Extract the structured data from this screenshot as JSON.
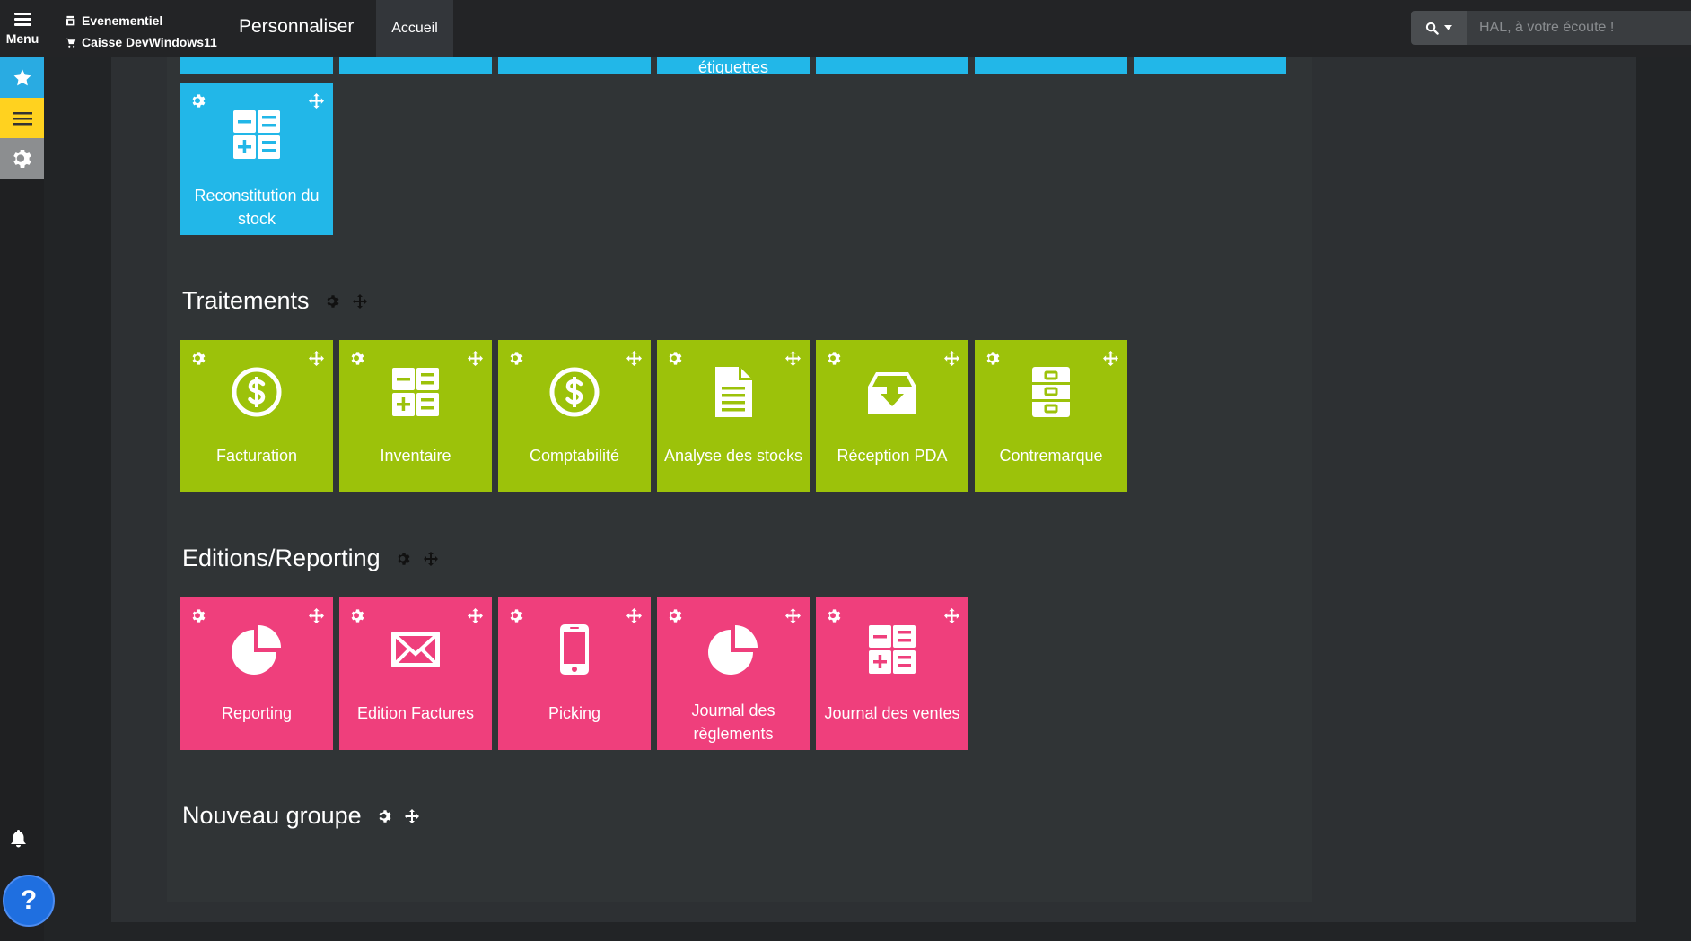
{
  "topbar": {
    "menu_label": "Menu",
    "site_line1": "Evenementiel",
    "site_line2": "Caisse DevWindows11",
    "title": "Personnaliser",
    "tab_home": "Accueil",
    "search_placeholder": "HAL, à votre écoute !"
  },
  "help_label": "?",
  "groups": {
    "top_partial": {
      "cut_label": "étiquettes"
    },
    "stock_tile": {
      "label": "Reconstitution du stock"
    },
    "traitements": {
      "title": "Traitements",
      "tiles": [
        {
          "label": "Facturation",
          "icon": "dollar-circle-icon"
        },
        {
          "label": "Inventaire",
          "icon": "calculator-icon"
        },
        {
          "label": "Comptabilité",
          "icon": "dollar-circle-icon"
        },
        {
          "label": "Analyse des stocks",
          "icon": "document-icon"
        },
        {
          "label": "Réception PDA",
          "icon": "inbox-download-icon"
        },
        {
          "label": "Contremarque",
          "icon": "cabinet-icon"
        }
      ]
    },
    "editions": {
      "title": "Editions/Reporting",
      "tiles": [
        {
          "label": "Reporting",
          "icon": "pie-chart-icon"
        },
        {
          "label": "Edition Factures",
          "icon": "envelope-icon"
        },
        {
          "label": "Picking",
          "icon": "mobile-phone-icon"
        },
        {
          "label": "Journal des règlements",
          "icon": "pie-chart-icon"
        },
        {
          "label": "Journal des ventes",
          "icon": "calculator-icon"
        }
      ]
    },
    "nouveau": {
      "title": "Nouveau groupe"
    }
  },
  "colors": {
    "blue": "#22b7e8",
    "green": "#9cc20a",
    "pink": "#ef3f7c",
    "rail_star": "#29abe2",
    "rail_list": "#ffd21f"
  }
}
